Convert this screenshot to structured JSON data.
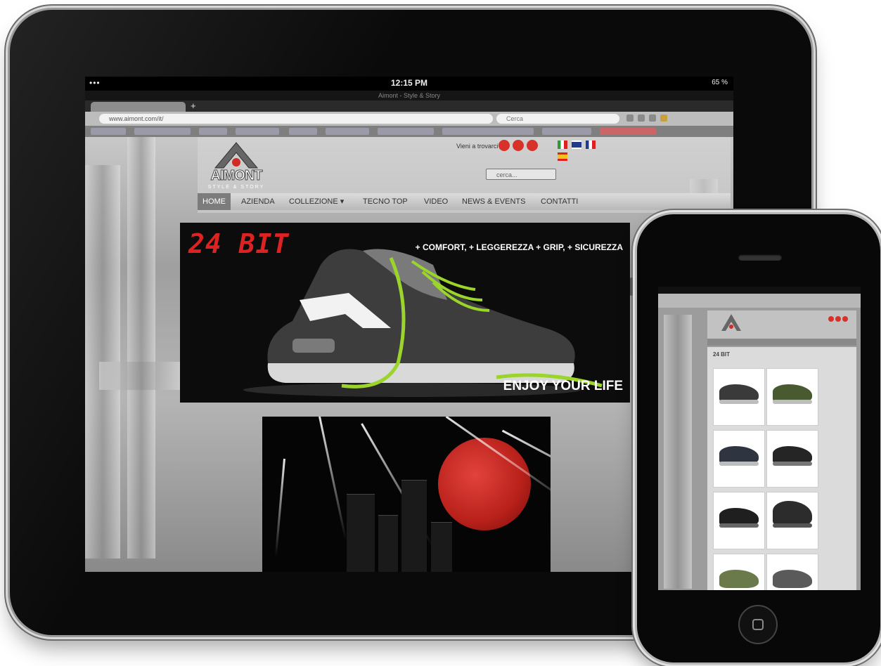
{
  "ipad": {
    "status": {
      "time": "12:15 PM",
      "signal": "•••",
      "battery": "65 %"
    },
    "browser": {
      "window_title": "Aimont - Style & Story",
      "url": "www.aimont.com/it/",
      "search_placeholder": "Cerca"
    },
    "site": {
      "logo": "AIMONT",
      "logo_sub": "STYLE & STORY",
      "follow_label": "Vieni a trovarci",
      "search_placeholder": "cerca...",
      "nav": [
        "HOME",
        "AZIENDA",
        "COLLEZIONE ▾",
        "TECNO TOP",
        "VIDEO",
        "NEWS & EVENTS",
        "CONTATTI"
      ],
      "active_nav": "HOME",
      "banner": {
        "title": "24 BIT",
        "tagline": "+ COMFORT, + LEGGEREZZA + GRIP, + SICUREZZA",
        "cta": "ENJOY YOUR LIFE"
      },
      "flags": [
        "it-flag",
        "uk-flag",
        "fr-flag",
        "es-flag"
      ],
      "social": [
        "youtube-icon",
        "facebook-icon",
        "twitter-icon"
      ]
    }
  },
  "iphone": {
    "heading": "24 BIT"
  },
  "colors": {
    "accent_red": "#d22a24",
    "lime": "#9bd42a",
    "nav_active": "#7c7c7c"
  }
}
